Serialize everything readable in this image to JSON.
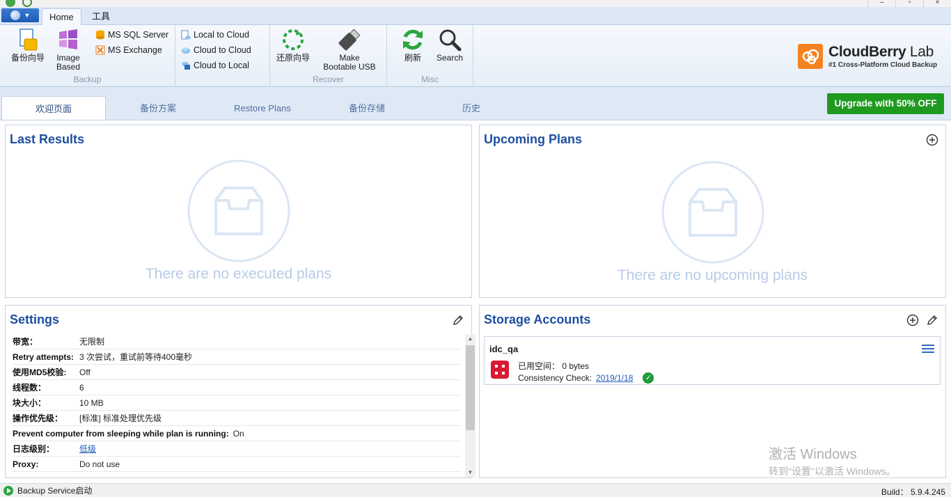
{
  "ribbon": {
    "tabs": [
      "Home",
      "工具"
    ],
    "backup_wizard": "备份向导",
    "image_based": [
      "Image",
      "Based"
    ],
    "ms_sql": "MS SQL Server",
    "ms_exchange": "MS Exchange",
    "local_to_cloud": "Local to Cloud",
    "cloud_to_cloud": "Cloud to Cloud",
    "cloud_to_local": "Cloud to Local",
    "backup_group": "Backup",
    "restore_wizard": "还原向导",
    "make_usb": [
      "Make",
      "Bootable USB"
    ],
    "recover_group": "Recover",
    "refresh": "刷新",
    "search": "Search",
    "misc_group": "Misc"
  },
  "logo": {
    "name_bold": "CloudBerry",
    "name_light": " Lab",
    "tagline": "#1 Cross-Platform Cloud Backup",
    "color": "#f58220"
  },
  "page_tabs": [
    "欢迎页面",
    "备份方案",
    "Restore Plans",
    "备份存储",
    "历史"
  ],
  "upgrade_label": "Upgrade with 50% OFF",
  "last_results": {
    "title": "Last Results",
    "empty": "There are no executed plans"
  },
  "upcoming": {
    "title": "Upcoming Plans",
    "empty": "There are no upcoming plans"
  },
  "settings": {
    "title": "Settings",
    "rows": [
      {
        "k": "带宽：",
        "v": "无限制"
      },
      {
        "k": "Retry attempts:",
        "v": "3 次尝试，重试前等待400毫秒"
      },
      {
        "k": "使用MD5校验:",
        "v": "Off"
      },
      {
        "k": "线程数：",
        "v": "6"
      },
      {
        "k": "块大小：",
        "v": "10 MB"
      },
      {
        "k": "操作优先级：",
        "v": "[标准] 标准处理优先级"
      },
      {
        "k": "Prevent computer from sleeping while plan is running:",
        "v": "On"
      },
      {
        "k": "日志级别：",
        "v": "低级"
      },
      {
        "k": "Proxy:",
        "v": "Do not use"
      }
    ]
  },
  "storage": {
    "title": "Storage Accounts",
    "account": {
      "name": "idc_qa",
      "used_label": "已用空间：",
      "used_value": "0 bytes",
      "check_label": "Consistency Check:",
      "check_date": "2019/1/18"
    }
  },
  "watermark": {
    "line1": "激活 Windows",
    "line2": "转到\"设置\"以激活 Windows。"
  },
  "status": {
    "text": "Backup Service启动",
    "build": "Build：  5.9.4.245"
  }
}
